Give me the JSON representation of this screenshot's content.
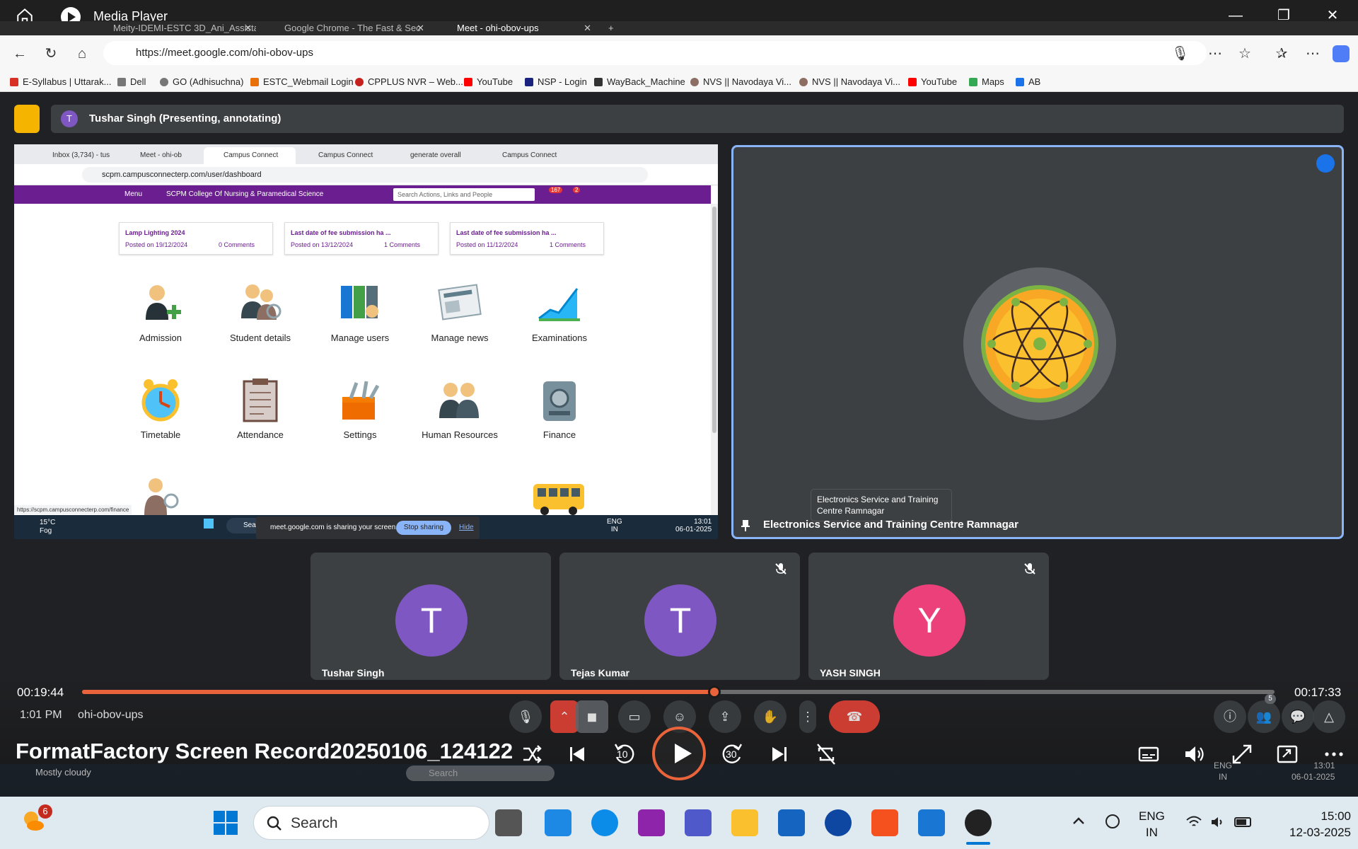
{
  "media_player": {
    "app_title": "Media Player",
    "video_title": "FormatFactory Screen Record20250106_124122",
    "position_time": "00:19:44",
    "remaining_time": "00:17:33",
    "progress_fraction": 0.53,
    "skip_back_label": "10",
    "skip_forward_label": "30"
  },
  "browser": {
    "tabs": [
      {
        "label": "Meity-IDEMI-ESTC 3D_Ani_Assista"
      },
      {
        "label": "Google Chrome - The Fast & Sec"
      },
      {
        "label": "Meet - ohi-obov-ups"
      }
    ],
    "url": "https://meet.google.com/ohi-obov-ups",
    "bookmarks": [
      {
        "label": "E-Syllabus | Uttarak...",
        "color": "#d93025"
      },
      {
        "label": "Dell",
        "color": "#555555"
      },
      {
        "label": "GO (Adhisuchna)",
        "color": "#555555"
      },
      {
        "label": "ESTC_Webmail Login",
        "color": "#e8710a"
      },
      {
        "label": "CPPLUS NVR – Web...",
        "color": "#c5221f"
      },
      {
        "label": "YouTube",
        "color": "#ff0000"
      },
      {
        "label": "NSP - Login",
        "color": "#1a237e"
      },
      {
        "label": "WayBack_Machine",
        "color": "#333333"
      },
      {
        "label": "NVS || Navodaya Vi...",
        "color": "#8d6e63"
      },
      {
        "label": "NVS || Navodaya Vi...",
        "color": "#8d6e63"
      },
      {
        "label": "YouTube",
        "color": "#ff0000"
      },
      {
        "label": "Maps",
        "color": "#34a853"
      },
      {
        "label": "AB",
        "color": "#1a73e8"
      }
    ]
  },
  "meet": {
    "presenter_bar": "Tushar Singh (Presenting, annotating)",
    "presenter_initial": "T",
    "pinned_tooltip": "Electronics Service and Training Centre Ramnagar",
    "pinned_name": "Electronics Service and Training Centre Ramnagar",
    "participants": [
      {
        "initial": "T",
        "name": "Tushar Singh",
        "color": "#7e57c2",
        "muted": false
      },
      {
        "initial": "T",
        "name": "Tejas Kumar",
        "color": "#7e57c2",
        "muted": true
      },
      {
        "initial": "Y",
        "name": "YASH SINGH",
        "color": "#ec407a",
        "muted": true
      }
    ],
    "time": "1:01 PM",
    "meeting_code": "ohi-obov-ups",
    "people_count": "5"
  },
  "shared_screen": {
    "tabs": [
      {
        "label": "Inbox (3,734) - tus"
      },
      {
        "label": "Meet - ohi-ob"
      },
      {
        "label": "Campus Connect"
      },
      {
        "label": "Campus Connect"
      },
      {
        "label": "generate overall"
      },
      {
        "label": "Campus Connect"
      }
    ],
    "url": "scpm.campusconnecterp.com/user/dashboard",
    "menu_label": "Menu",
    "college": "SCPM College Of Nursing & Paramedical Science",
    "search_placeholder": "Search Actions, Links and People",
    "badge_1": "167",
    "badge_2": "2",
    "news": [
      {
        "title": "Lamp Lighting 2024",
        "date": "Posted on 19/12/2024",
        "comments": "0 Comments"
      },
      {
        "title": "Last date of fee submission ha ...",
        "date": "Posted on 13/12/2024",
        "comments": "1 Comments"
      },
      {
        "title": "Last date of fee submission ha ...",
        "date": "Posted on 11/12/2024",
        "comments": "1 Comments"
      }
    ],
    "modules_row1": [
      "Admission",
      "Student details",
      "Manage users",
      "Manage news",
      "Examinations"
    ],
    "modules_row2": [
      "Timetable",
      "Attendance",
      "Settings",
      "Human Resources",
      "Finance"
    ],
    "share_text": "meet.google.com is sharing your screen.",
    "stop_sharing": "Stop sharing",
    "hide": "Hide",
    "status_url": "https://scpm.campusconnecterp.com/finance",
    "weather_temp": "15°C",
    "weather_desc": "Fog",
    "taskbar_search": "Search",
    "lang_1": "ENG",
    "lang_2": "IN",
    "clock_time": "13:01",
    "clock_date": "06-01-2025"
  },
  "underlay": {
    "weather": "Mostly cloudy",
    "search": "Search",
    "lang_1": "ENG",
    "lang_2": "IN",
    "time": "13:01",
    "date": "06-01-2025"
  },
  "taskbar": {
    "search_placeholder": "Search",
    "weather_badge": "6",
    "lang_1": "ENG",
    "lang_2": "IN",
    "time": "15:00",
    "date": "12-03-2025"
  },
  "colors": {
    "accent": "#e9643a",
    "meet_bg": "#202124",
    "tile_bg": "#3c4043",
    "pinned_border": "#8ab4f8"
  }
}
